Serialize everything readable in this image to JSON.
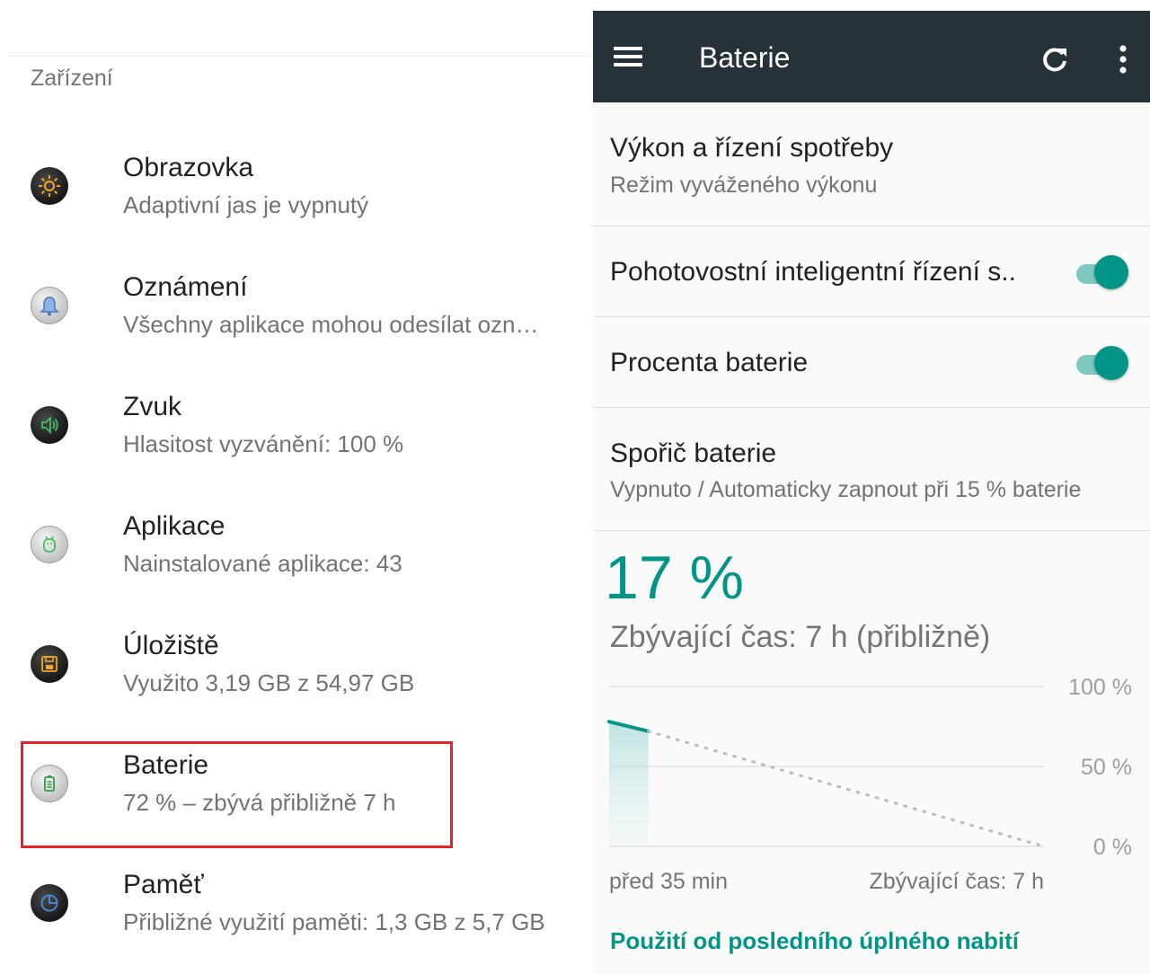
{
  "left": {
    "section_title": "Zařízení",
    "items": [
      {
        "title": "Obrazovka",
        "subtitle": "Adaptivní jas je vypnutý",
        "icon": "brightness-icon"
      },
      {
        "title": "Oznámení",
        "subtitle": "Všechny aplikace mohou odesílat ozn…",
        "icon": "bell-icon"
      },
      {
        "title": "Zvuk",
        "subtitle": "Hlasitost vyzvánění: 100 %",
        "icon": "speaker-icon"
      },
      {
        "title": "Aplikace",
        "subtitle": "Nainstalované aplikace: 43",
        "icon": "android-icon"
      },
      {
        "title": "Úložiště",
        "subtitle": "Využito 3,19 GB z 54,97 GB",
        "icon": "storage-icon"
      },
      {
        "title": "Baterie",
        "subtitle": "72 % – zbývá přibližně 7 h",
        "icon": "battery-icon"
      },
      {
        "title": "Paměť",
        "subtitle": "Přibližné využití paměti: 1,3 GB z 5,7 GB",
        "icon": "memory-icon"
      }
    ]
  },
  "right": {
    "toolbar": {
      "title": "Baterie"
    },
    "prefs": [
      {
        "title": "Výkon a řízení spotřeby",
        "subtitle": "Režim vyváženého výkonu"
      },
      {
        "title": "Pohotovostní inteligentní řízení s..",
        "toggle": true
      },
      {
        "title": "Procenta baterie",
        "toggle": true
      },
      {
        "title": "Spořič baterie",
        "subtitle": "Vypnuto / Automaticky zapnout při 15 % baterie"
      }
    ],
    "battery_percent": "17 %",
    "remaining_time": "Zbývající čas: 7 h (přibližně)",
    "usage_link": "Použití od posledního úplného nabití"
  },
  "chart_data": {
    "type": "line",
    "y_tick_labels": [
      "100 %",
      "50 %",
      "0 %"
    ],
    "ylim": [
      0,
      100
    ],
    "x_labels": [
      "před 35 min",
      "Zbývající čas: 7 h"
    ],
    "series": [
      {
        "style": "solid",
        "points": [
          [
            0,
            78
          ],
          [
            0.09,
            72
          ]
        ]
      },
      {
        "style": "dotted",
        "points": [
          [
            0.09,
            72
          ],
          [
            1,
            0
          ]
        ]
      }
    ],
    "colors": {
      "line": "#009587",
      "projection": "#b0bec5",
      "grid": "#e0e0e0"
    }
  }
}
